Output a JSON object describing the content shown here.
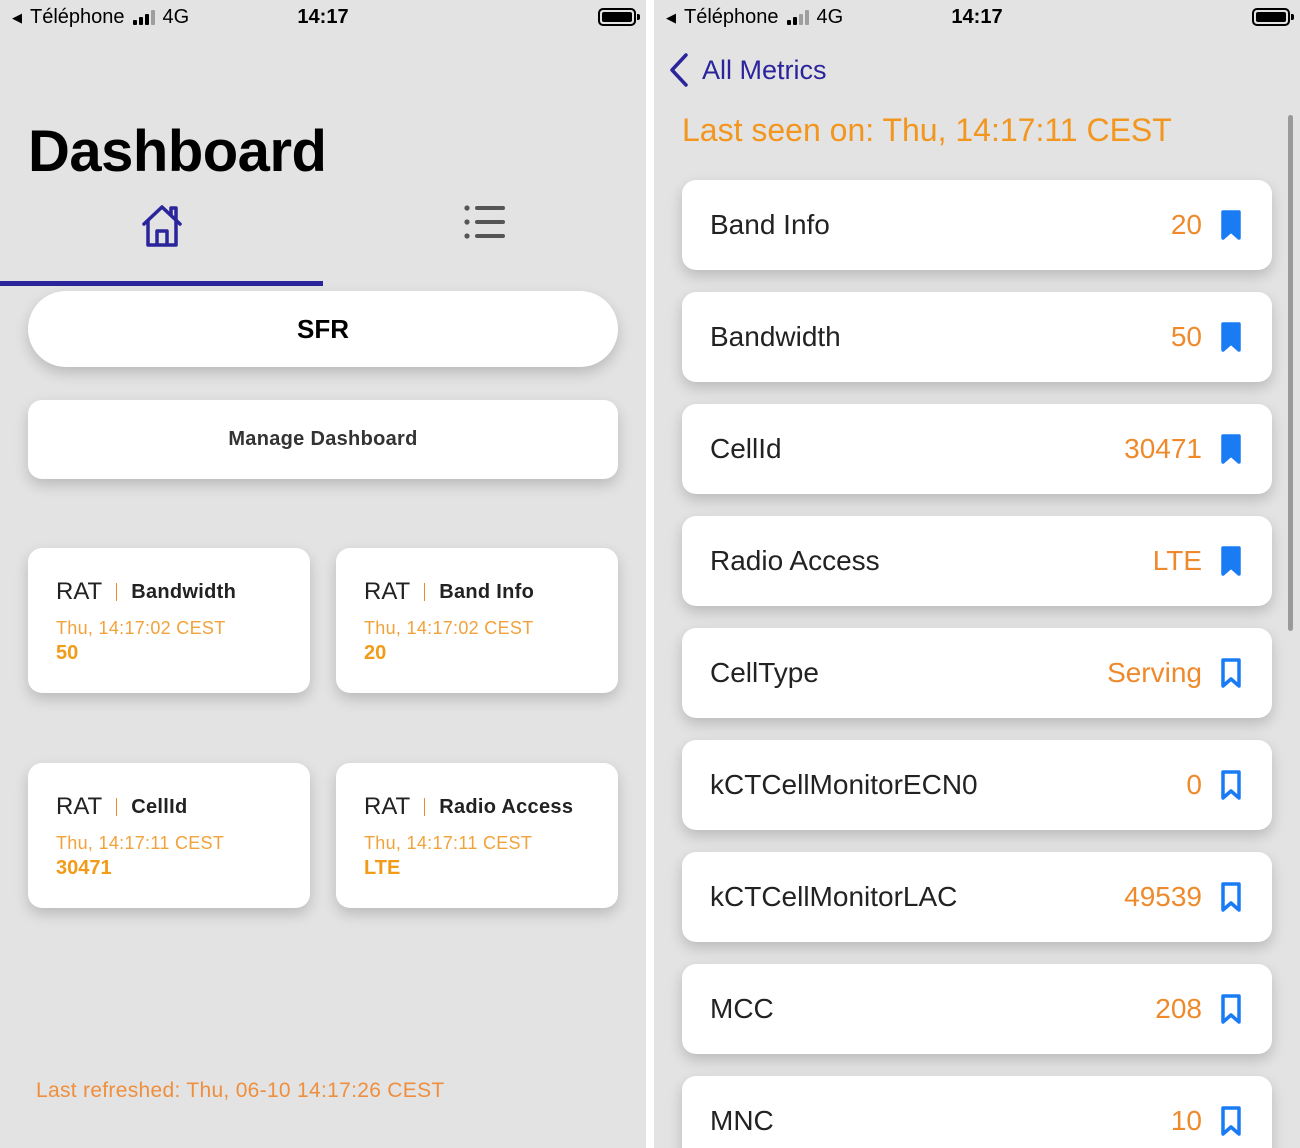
{
  "status_bar": {
    "back_glyph": "◀",
    "carrier": "Téléphone",
    "network": "4G",
    "time": "14:17"
  },
  "dashboard": {
    "title": "Dashboard",
    "tabs": [
      {
        "icon": "home-icon",
        "selected": true
      },
      {
        "icon": "list-icon",
        "selected": false
      }
    ],
    "operator": "SFR",
    "manage_button": "Manage Dashboard",
    "cards": [
      {
        "prefix": "RAT",
        "name": "Bandwidth",
        "timestamp": "Thu, 14:17:02 CEST",
        "value": "50"
      },
      {
        "prefix": "RAT",
        "name": "Band Info",
        "timestamp": "Thu, 14:17:02 CEST",
        "value": "20"
      },
      {
        "prefix": "RAT",
        "name": "CellId",
        "timestamp": "Thu, 14:17:11 CEST",
        "value": "30471"
      },
      {
        "prefix": "RAT",
        "name": "Radio Access",
        "timestamp": "Thu, 14:17:11 CEST",
        "value": "LTE"
      }
    ],
    "last_refreshed": "Last refreshed: Thu, 06-10 14:17:26 CEST"
  },
  "metrics": {
    "back_label": "All Metrics",
    "last_seen": "Last seen on: Thu, 14:17:11 CEST",
    "rows": [
      {
        "label": "Band Info",
        "value": "20",
        "bookmarked": true
      },
      {
        "label": "Bandwidth",
        "value": "50",
        "bookmarked": true
      },
      {
        "label": "CellId",
        "value": "30471",
        "bookmarked": true
      },
      {
        "label": "Radio Access",
        "value": "LTE",
        "bookmarked": true
      },
      {
        "label": "CellType",
        "value": "Serving",
        "bookmarked": false
      },
      {
        "label": "kCTCellMonitorECN0",
        "value": "0",
        "bookmarked": false
      },
      {
        "label": "kCTCellMonitorLAC",
        "value": "49539",
        "bookmarked": false
      },
      {
        "label": "MCC",
        "value": "208",
        "bookmarked": false
      },
      {
        "label": "MNC",
        "value": "10",
        "bookmarked": false
      }
    ]
  },
  "colors": {
    "accent_blue": "#2b259c",
    "bookmark_blue": "#1a7cf5",
    "orange": "#ee8a2c",
    "background": "#e3e3e3"
  }
}
